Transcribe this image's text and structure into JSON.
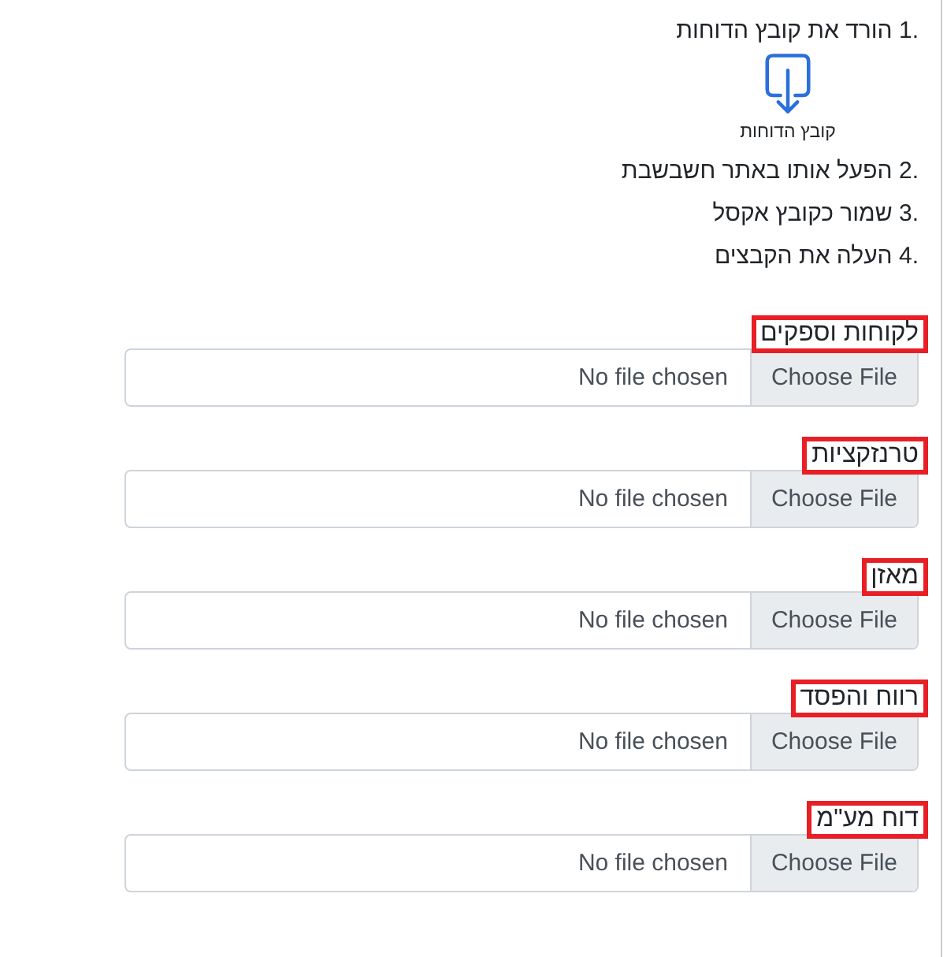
{
  "steps": [
    {
      "number": "1.",
      "text": "הורד את קובץ הדוחות"
    },
    {
      "number": "2.",
      "text": "הפעל אותו באתר חשבשבת"
    },
    {
      "number": "3.",
      "text": "שמור כקובץ אקסל"
    },
    {
      "number": "4.",
      "text": "העלה את הקבצים"
    }
  ],
  "download": {
    "caption": "קובץ הדוחות"
  },
  "fields": [
    {
      "label": "לקוחות וספקים",
      "highlighted": true,
      "button": "Choose File",
      "status": "No file chosen"
    },
    {
      "label": "טרנזקציות",
      "highlighted": true,
      "button": "Choose File",
      "status": "No file chosen"
    },
    {
      "label": "מאזן",
      "highlighted": true,
      "button": "Choose File",
      "status": "No file chosen"
    },
    {
      "label": "רווח והפסד",
      "highlighted": true,
      "button": "Choose File",
      "status": "No file chosen"
    },
    {
      "label": "דוח מע\"מ",
      "highlighted": true,
      "button": "Choose File",
      "status": "No file chosen"
    }
  ]
}
